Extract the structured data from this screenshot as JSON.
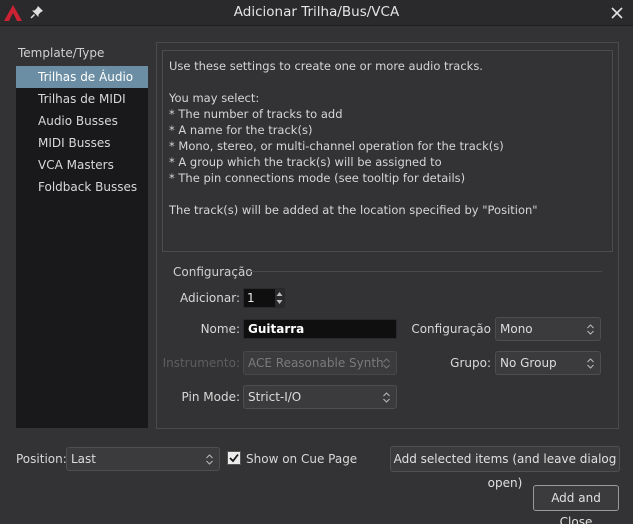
{
  "window": {
    "title": "Adicionar Trilha/Bus/VCA"
  },
  "colors": {
    "accent_selected": "#6c8ea4",
    "logo_red": "#cc2233",
    "background": "#333335",
    "list_background": "#19191b"
  },
  "sidebar": {
    "header": "Template/Type",
    "items": [
      {
        "label": "Trilhas de Áudio",
        "selected": true
      },
      {
        "label": "Trilhas de MIDI"
      },
      {
        "label": "Audio Busses"
      },
      {
        "label": "MIDI Busses"
      },
      {
        "label": "VCA Masters"
      },
      {
        "label": "Foldback Busses"
      }
    ]
  },
  "description": {
    "lines": [
      "Use these settings to create one or more audio tracks.",
      "",
      "You may select:",
      "* The number of tracks to add",
      "* A name for the track(s)",
      "* Mono, stereo, or multi-channel operation for the track(s)",
      "* A group which the track(s) will be assigned to",
      "* The pin connections mode (see tooltip for details)",
      "",
      "The track(s) will be added at the location specified by \"Position\""
    ]
  },
  "config": {
    "section_label": "Configuração",
    "add_label": "Adicionar:",
    "add_value": "1",
    "name_label": "Nome:",
    "name_value": "Guitarra",
    "channel_label": "Configuração",
    "channel_value": "Mono",
    "instrument_label": "Instrumento:",
    "instrument_value": "ACE Reasonable Synth",
    "group_label": "Grupo:",
    "group_value": "No Group",
    "pin_mode_label": "Pin Mode:",
    "pin_mode_value": "Strict-I/O"
  },
  "footer": {
    "position_label": "Position:",
    "position_value": "Last",
    "show_cue_label": "Show on Cue Page",
    "show_cue_checked": true,
    "add_selected_label": "Add selected items (and leave dialog open)",
    "add_close_label": "Add and Close"
  },
  "icons": {
    "logo": "ardour-logo-icon",
    "pin": "pin-icon",
    "close": "close-icon",
    "updown": "updown-arrows-icon",
    "check": "checkmark-icon"
  }
}
